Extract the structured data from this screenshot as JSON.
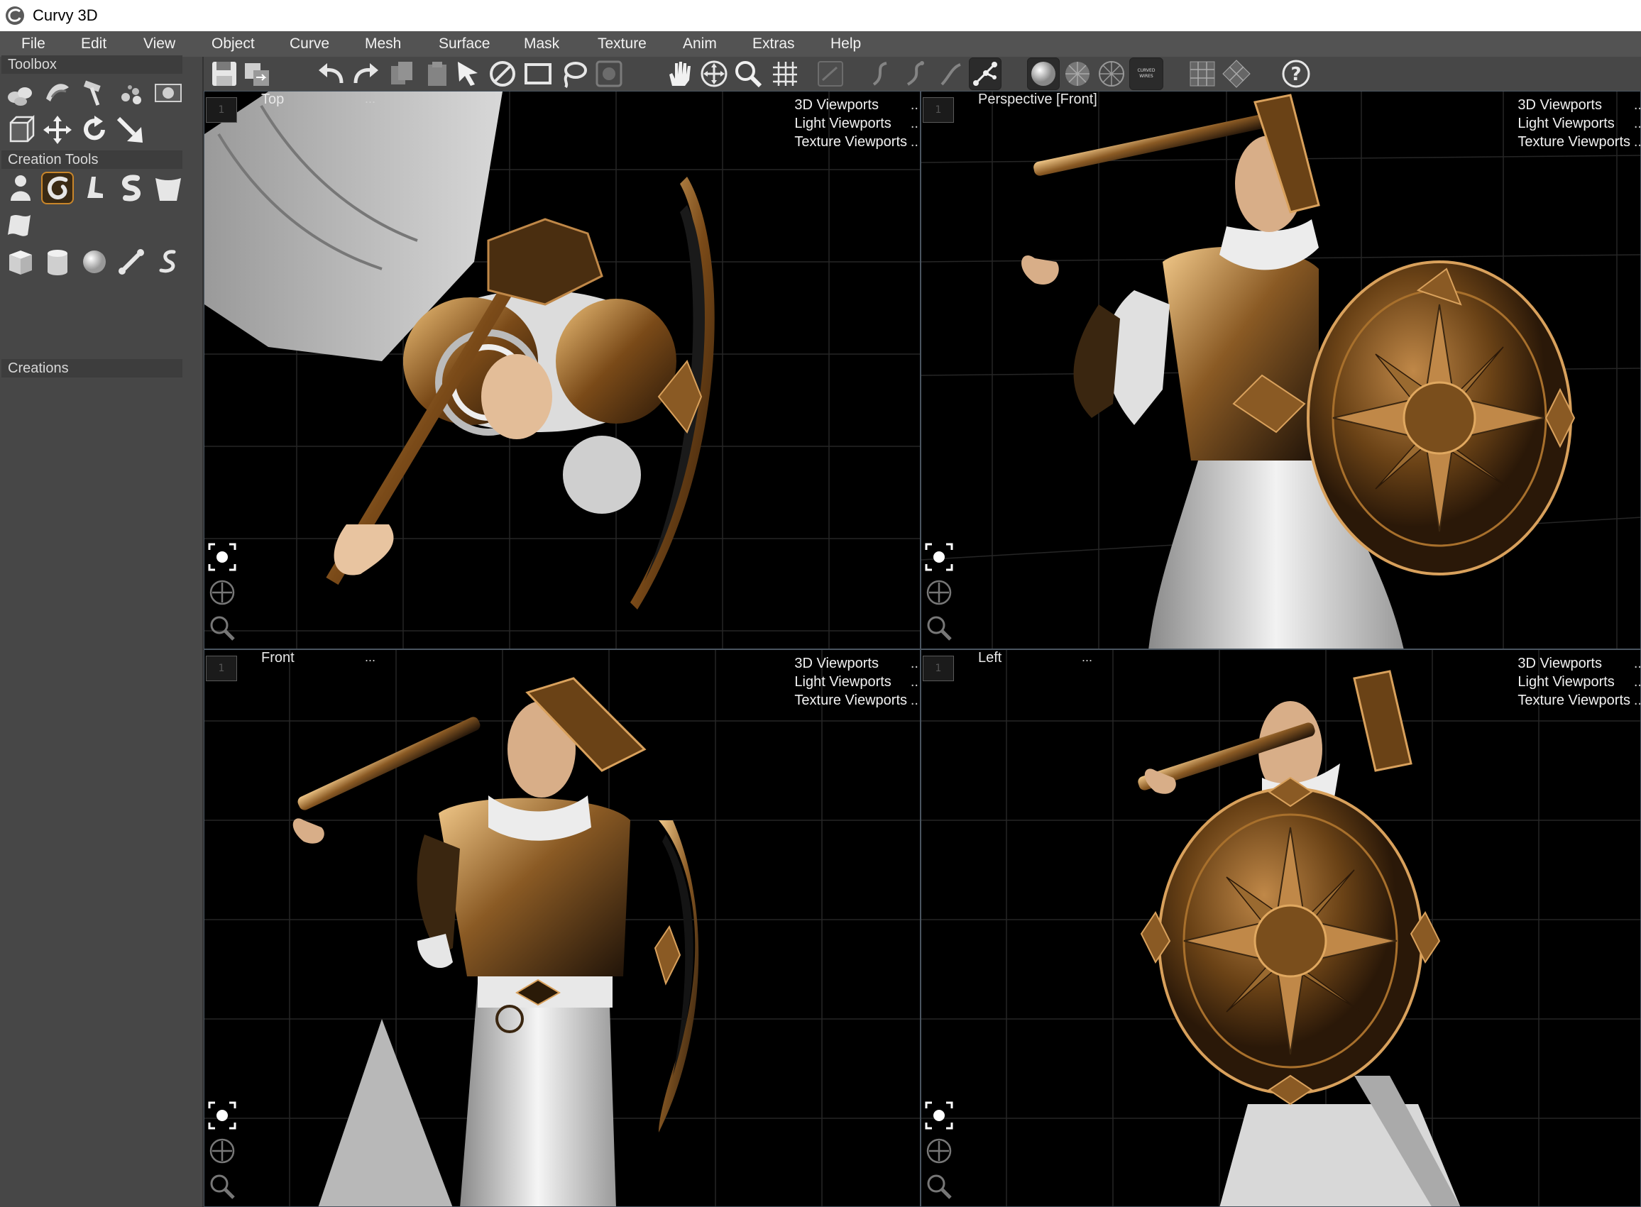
{
  "window": {
    "title": "Curvy 3D",
    "logo_icon": "curvy-swirl-logo-icon"
  },
  "menubar": {
    "items": [
      {
        "label": "File"
      },
      {
        "label": "Edit"
      },
      {
        "label": "View"
      },
      {
        "label": "Object"
      },
      {
        "label": "Curve"
      },
      {
        "label": "Mesh"
      },
      {
        "label": "Surface"
      },
      {
        "label": "Mask"
      },
      {
        "label": "Texture"
      },
      {
        "label": "Anim"
      },
      {
        "label": "Extras"
      },
      {
        "label": "Help"
      }
    ]
  },
  "leftpanel": {
    "toolbox_header": "Toolbox",
    "creation_tools_header": "Creation Tools",
    "creations_header": "Creations",
    "toolbox_icons": [
      "clone-icon",
      "twist-icon",
      "hammer-icon",
      "scatter-icon",
      "mask-icon",
      "bounding-box-icon",
      "move-icon",
      "rotate-icon",
      "scale-arrow-icon"
    ],
    "creation_icons": [
      "figure-icon",
      "curl-icon",
      "boot-icon",
      "s-curve-icon",
      "cup-icon",
      "flag-icon",
      "cube-icon",
      "cylinder-icon",
      "sphere-icon",
      "bone-icon",
      "hook-icon"
    ],
    "selected_creation_tool": "curl-icon"
  },
  "toolbar": {
    "buttons": [
      "save-icon",
      "export-icon",
      "undo-icon",
      "redo-icon",
      "copy-icon",
      "paste-icon",
      "select-arrow-icon",
      "no-select-icon",
      "rectangle-select-icon",
      "lasso-icon",
      "paint-select-icon",
      "pan-hand-icon",
      "move-view-icon",
      "zoom-icon",
      "grid-icon",
      "draw-icon",
      "curve-a-icon",
      "curve-b-icon",
      "curve-c-icon",
      "curve-nodes-icon",
      "solid-shading-icon",
      "wire-shading-icon",
      "wire-only-icon",
      "curved-wires-icon",
      "grid-view-icon",
      "rotate-view-icon",
      "help-icon"
    ],
    "curved_wires_label": "CURVED\nWIRES",
    "help_label": "?"
  },
  "viewports": [
    {
      "id": "top",
      "name": "Top",
      "dots": "...",
      "links": [
        "3D Viewports",
        "Light Viewports",
        "Texture Viewports"
      ],
      "link_dots": "..",
      "number": "1"
    },
    {
      "id": "persp",
      "name": "Perspective [Front]",
      "dots": "",
      "links": [
        "3D Viewports",
        "Light Viewports",
        "Texture Viewports"
      ],
      "link_dots": "..",
      "number": "1"
    },
    {
      "id": "front",
      "name": "Front",
      "dots": "...",
      "links": [
        "3D Viewports",
        "Light Viewports",
        "Texture Viewports"
      ],
      "link_dots": "..",
      "number": "1"
    },
    {
      "id": "left",
      "name": "Left",
      "dots": "...",
      "links": [
        "3D Viewports",
        "Light Viewports",
        "Texture Viewports"
      ],
      "link_dots": "..",
      "number": "1"
    }
  ],
  "colors": {
    "bronze": "#8a5a24",
    "bronze_light": "#d9a15c",
    "cloth": "#e8e8e8",
    "skin": "#d9b08c",
    "grid": "#2a2a2a",
    "panel": "#474747",
    "menu": "#535353",
    "selected_outline": "#c9862a"
  }
}
